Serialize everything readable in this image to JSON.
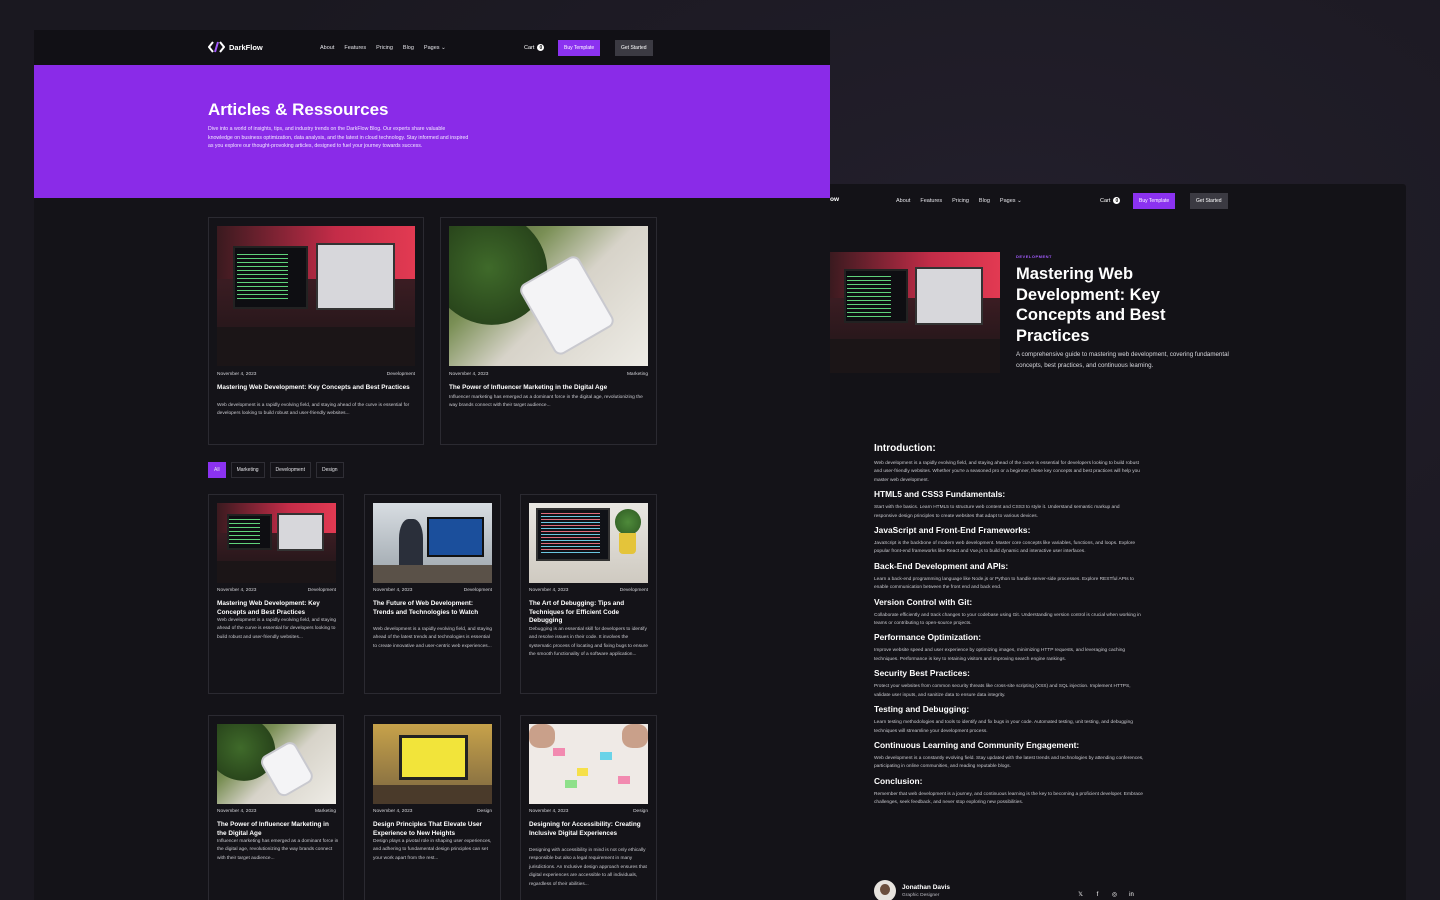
{
  "brand": {
    "name": "DarkFlow",
    "name_fragment": "ow"
  },
  "nav": {
    "links": [
      "About",
      "Features",
      "Pricing",
      "Blog",
      "Pages"
    ],
    "cart_label": "Cart",
    "cart_count": "0",
    "buy_label": "Buy Template",
    "start_label": "Get Started"
  },
  "colors": {
    "accent": "#8b32f0",
    "background": "#141318"
  },
  "blog": {
    "title": "Articles & Ressources",
    "intro": "Dive into a world of insights, tips, and industry trends on the DarkFlow Blog. Our experts share valuable knowledge on business optimization, data analysis, and the latest in cloud technology. Stay informed and inspired as you explore our thought-provoking articles, designed to fuel your journey towards success.",
    "featured": [
      {
        "date": "November 4, 2023",
        "category": "Development",
        "title": "Mastering Web Development: Key Concepts and Best Practices",
        "excerpt": "Web development is a rapidly evolving field, and staying ahead of the curve is essential for developers looking to build robust and user-friendly websites..."
      },
      {
        "date": "November 4, 2023",
        "category": "Marketing",
        "title": "The Power of Influencer Marketing in the Digital Age",
        "excerpt": "Influencer marketing has emerged as a dominant force in the digital age, revolutionizing the way brands connect with their target audience..."
      }
    ],
    "filters": [
      "All",
      "Marketing",
      "Development",
      "Design"
    ],
    "active_filter": "All",
    "posts": [
      {
        "date": "November 4, 2023",
        "category": "Development",
        "title": "Mastering Web Development: Key Concepts and Best Practices",
        "excerpt": "Web development is a rapidly evolving field, and staying ahead of the curve is essential for developers looking to build robust and user-friendly websites..."
      },
      {
        "date": "November 4, 2023",
        "category": "Development",
        "title": "The Future of Web Development: Trends and Technologies to Watch",
        "excerpt": "Web development is a rapidly evolving field, and staying ahead of the latest trends and technologies is essential to create innovative and user-centric web experiences..."
      },
      {
        "date": "November 4, 2023",
        "category": "Development",
        "title": "The Art of Debugging: Tips and Techniques for Efficient Code Debugging",
        "excerpt": "Debugging is an essential skill for developers to identify and resolve issues in their code. It involves the systematic process of locating and fixing bugs to ensure the smooth functionality of a software application..."
      },
      {
        "date": "November 4, 2023",
        "category": "Marketing",
        "title": "The Power of Influencer Marketing in the Digital Age",
        "excerpt": "Influencer marketing has emerged as a dominant force in the digital age, revolutionizing the way brands connect with their target audience..."
      },
      {
        "date": "November 4, 2023",
        "category": "Design",
        "title": "Design Principles That Elevate User Experience to New Heights",
        "excerpt": "Design plays a pivotal role in shaping user experiences, and adhering to fundamental design principles can set your work apart from the rest..."
      },
      {
        "date": "November 4, 2023",
        "category": "Design",
        "title": "Designing for Accessibility: Creating Inclusive Digital Experiences",
        "excerpt": "Designing with accessibility in mind is not only ethically responsible but also a legal requirement in many jurisdictions. An Inclusive design approach ensures that digital experiences are accessible to all individuals, regardless of their abilities..."
      }
    ]
  },
  "article": {
    "category": "DEVELOPMENT",
    "title": "Mastering Web Development: Key Concepts and Best Practices",
    "summary": "A comprehensive guide to mastering web development, covering fundamental concepts, best practices, and continuous learning.",
    "sections": [
      {
        "heading": "Introduction:",
        "body": "Web development is a rapidly evolving field, and staying ahead of the curve is essential for developers looking to build robust and user-friendly websites. Whether you're a seasoned pro or a beginner, these key concepts and best practices will help you master web development."
      },
      {
        "heading": "HTML5 and CSS3 Fundamentals:",
        "body": "Start with the basics. Learn HTML5 to structure web content and CSS3 to style it. Understand semantic markup and responsive design principles to create websites that adapt to various devices."
      },
      {
        "heading": "JavaScript and Front-End Frameworks:",
        "body": "JavaScript is the backbone of modern web development. Master core concepts like variables, functions, and loops. Explore popular front-end frameworks like React and Vue.js to build dynamic and interactive user interfaces."
      },
      {
        "heading": "Back-End Development and APIs:",
        "body": "Learn a back-end programming language like Node.js or Python to handle server-side processes. Explore RESTful APIs to enable communication between the front end and back end."
      },
      {
        "heading": "Version Control with Git:",
        "body": "Collaborate efficiently and track changes to your codebase using Git. Understanding version control is crucial when working in teams or contributing to open-source projects."
      },
      {
        "heading": "Performance Optimization:",
        "body": "Improve website speed and user experience by optimizing images, minimizing HTTP requests, and leveraging caching techniques. Performance is key to retaining visitors and improving search engine rankings."
      },
      {
        "heading": "Security Best Practices:",
        "body": "Protect your websites from common security threats like cross-site scripting (XSS) and SQL injection. Implement HTTPS, validate user inputs, and sanitize data to ensure data integrity."
      },
      {
        "heading": "Testing and Debugging:",
        "body": "Learn testing methodologies and tools to identify and fix bugs in your code. Automated testing, unit testing, and debugging techniques will streamline your development process."
      },
      {
        "heading": "Continuous Learning and Community Engagement:",
        "body": "Web development is a constantly evolving field. Stay updated with the latest trends and technologies by attending conferences, participating in online communities, and reading reputable blogs."
      },
      {
        "heading": "Conclusion:",
        "body": "Remember that web development is a journey, and continuous learning is the key to becoming a proficient developer. Embrace challenges, seek feedback, and never stop exploring new possibilities."
      }
    ],
    "author": {
      "name": "Jonathan Davis",
      "role": "Graphic Designer"
    },
    "social_icons": [
      "x-icon",
      "facebook-icon",
      "instagram-icon",
      "linkedin-icon"
    ]
  }
}
